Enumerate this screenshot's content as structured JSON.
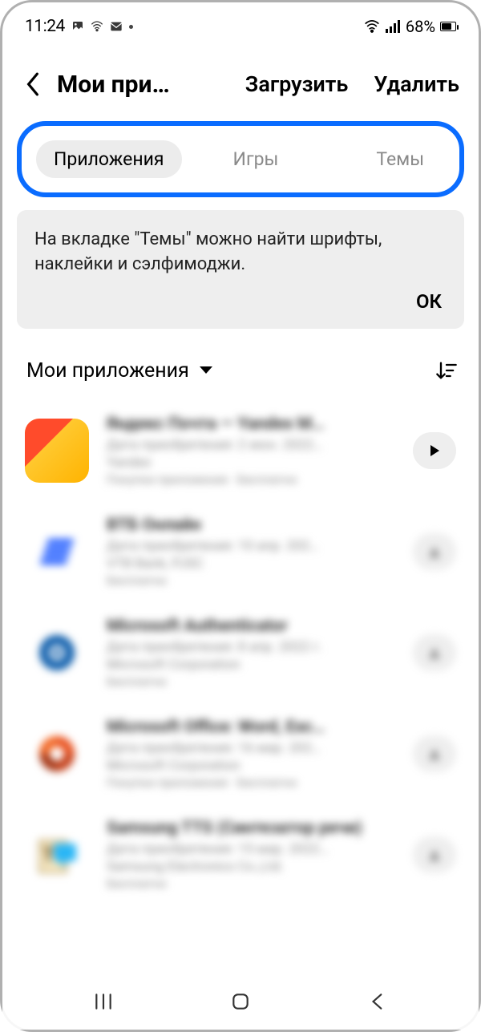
{
  "status": {
    "time": "11:24",
    "battery_pct": "68%"
  },
  "header": {
    "title": "Мои при…",
    "download": "Загрузить",
    "delete": "Удалить"
  },
  "tabs": {
    "apps": "Приложения",
    "games": "Игры",
    "themes": "Темы"
  },
  "info": {
    "text": "На вкладке \"Темы\" можно найти шрифты, наклейки и сэлфимоджи.",
    "ok": "ОК"
  },
  "section": {
    "title": "Мои приложения"
  },
  "apps": [
    {
      "name": "Яндекс Почта — Yandex M…",
      "sub": "Дата приобретения: 2 июн. 2022…",
      "pub": "Yandex",
      "tag": "Покупки приложения · Бесплатно"
    },
    {
      "name": "ВТБ Онлайн",
      "sub": "Дата приобретения: 10 апр. 202…",
      "pub": "VTB Bank, PJSC",
      "tag": "Бесплатно"
    },
    {
      "name": "Microsoft Authenticator",
      "sub": "Дата приобретения: 8 апр. 2022 г.",
      "pub": "Microsoft Corporation",
      "tag": "Бесплатно"
    },
    {
      "name": "Microsoft Office: Word, Exc…",
      "sub": "Дата приобретения: 16 мар. 202…",
      "pub": "Microsoft Corporation",
      "tag": "Покупки приложения · Бесплатно"
    },
    {
      "name": "Samsung TTS (Синтезатор речи)",
      "sub": "Дата приобретения: 15 мар. 2022…",
      "pub": "Samsung Electronics Co.,Ltd.",
      "tag": "Бесплатно"
    }
  ]
}
